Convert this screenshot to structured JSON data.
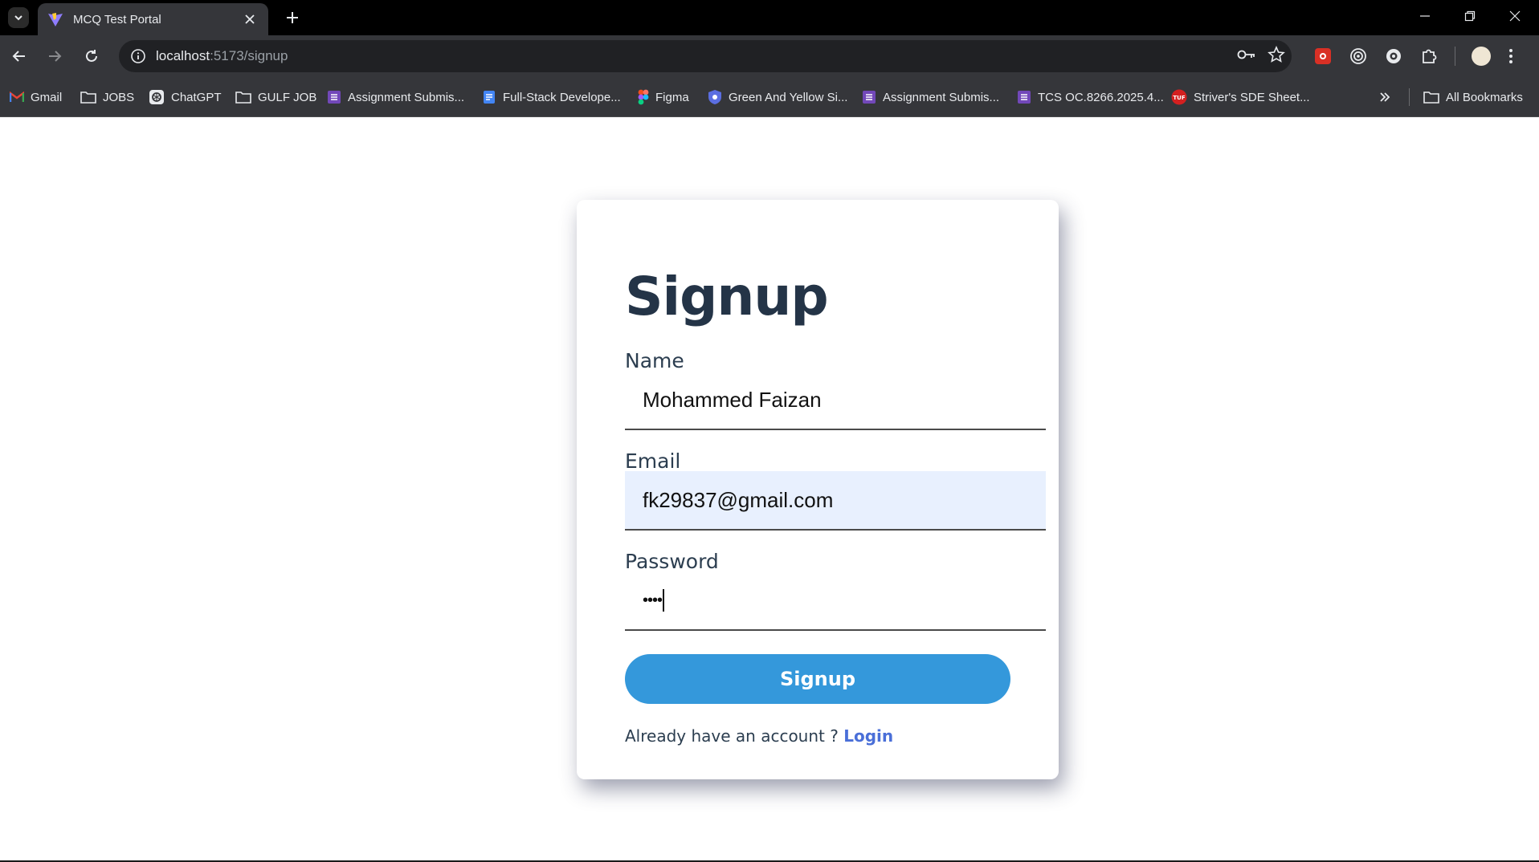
{
  "browser": {
    "tab_title": "MCQ Test Portal",
    "url_host": "localhost",
    "url_path": ":5173/signup",
    "bookmarks": [
      {
        "label": "Gmail",
        "icon": "gmail-icon"
      },
      {
        "label": "JOBS",
        "icon": "folder-icon"
      },
      {
        "label": "ChatGPT",
        "icon": "chatgpt-icon"
      },
      {
        "label": "GULF JOB",
        "icon": "folder-icon"
      },
      {
        "label": "Assignment Submis...",
        "icon": "forms-icon"
      },
      {
        "label": "Full-Stack Develope...",
        "icon": "docs-icon"
      },
      {
        "label": "Figma",
        "icon": "figma-icon"
      },
      {
        "label": "Green And Yellow Si...",
        "icon": "shield-icon"
      },
      {
        "label": "Assignment Submis...",
        "icon": "forms-icon"
      },
      {
        "label": "TCS OC.8266.2025.4...",
        "icon": "forms-icon"
      },
      {
        "label": "Striver's SDE Sheet...",
        "icon": "tuf-icon"
      }
    ],
    "all_bookmarks_label": "All Bookmarks"
  },
  "form": {
    "title": "Signup",
    "name_label": "Name",
    "name_value": "Mohammed Faizan",
    "email_label": "Email",
    "email_value": "fk29837@gmail.com",
    "password_label": "Password",
    "password_mask": "••••",
    "submit_label": "Signup",
    "footer_text": "Already have an account ? ",
    "login_link": "Login"
  },
  "colors": {
    "primary_button": "#3498db",
    "heading": "#243447",
    "link": "#4a6fd8",
    "autofill_bg": "#e8f0fe"
  }
}
